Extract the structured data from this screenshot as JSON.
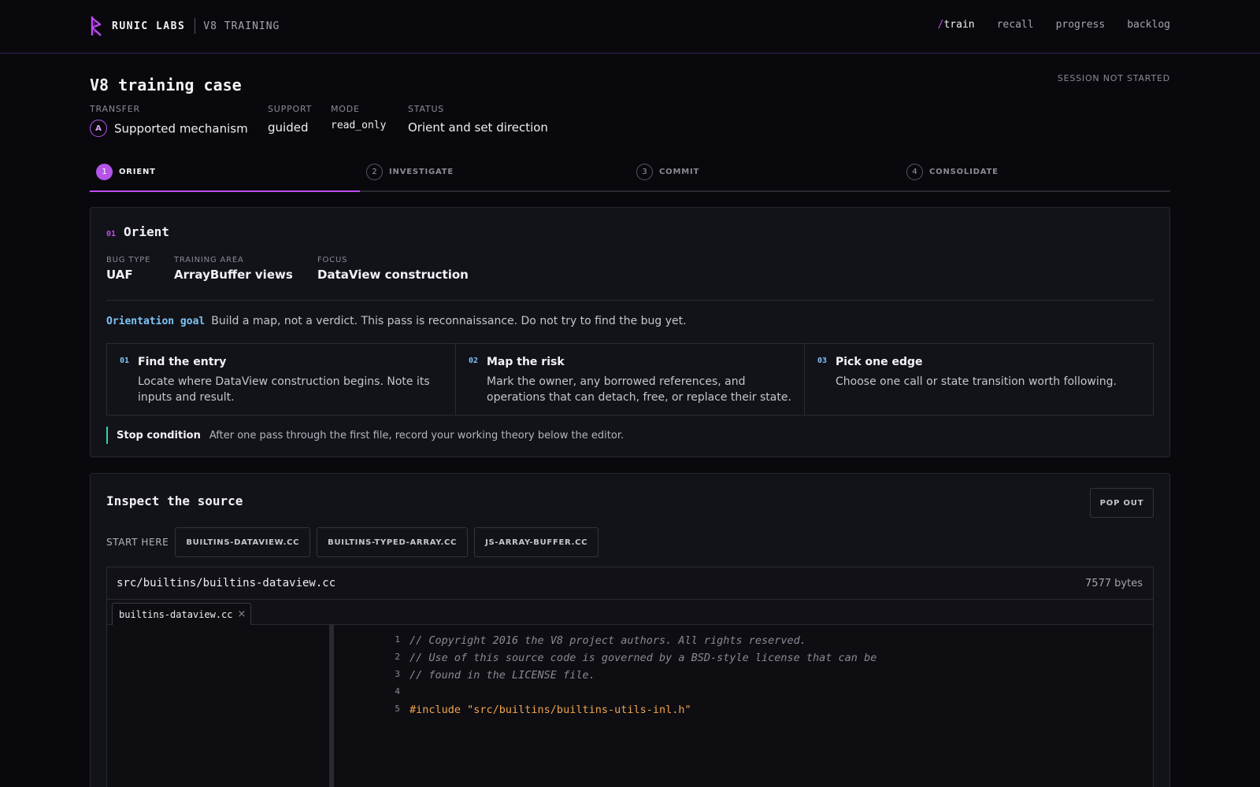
{
  "brand": {
    "name": "RUNIC LABS",
    "subtitle": "V8 TRAINING"
  },
  "nav": {
    "items": [
      {
        "prefix": "/",
        "label": "train",
        "active": true
      },
      {
        "label": "recall"
      },
      {
        "label": "progress"
      },
      {
        "label": "backlog"
      }
    ]
  },
  "header": {
    "title": "V8 training case",
    "session_status": "SESSION NOT STARTED",
    "meta": {
      "transfer": {
        "label": "TRANSFER",
        "badge": "A",
        "value": "Supported mechanism"
      },
      "support": {
        "label": "SUPPORT",
        "value": "guided"
      },
      "mode": {
        "label": "MODE",
        "value": "read_only"
      },
      "status": {
        "label": "STATUS",
        "value": "Orient and set direction"
      }
    }
  },
  "stepper": {
    "steps": [
      {
        "num": "1",
        "label": "ORIENT",
        "active": true
      },
      {
        "num": "2",
        "label": "INVESTIGATE"
      },
      {
        "num": "3",
        "label": "COMMIT"
      },
      {
        "num": "4",
        "label": "CONSOLIDATE"
      }
    ]
  },
  "orient": {
    "num": "01",
    "title": "Orient",
    "facts": [
      {
        "label": "BUG TYPE",
        "value": "UAF"
      },
      {
        "label": "TRAINING AREA",
        "value": "ArrayBuffer views"
      },
      {
        "label": "FOCUS",
        "value": "DataView construction"
      }
    ],
    "goal": {
      "label": "Orientation goal",
      "text": "Build a map, not a verdict. This pass is reconnaissance. Do not try to find the bug yet."
    },
    "tasks": [
      {
        "num": "01",
        "title": "Find the entry",
        "text": "Locate where DataView construction begins. Note its inputs and result."
      },
      {
        "num": "02",
        "title": "Map the risk",
        "text": "Mark the owner, any borrowed references, and operations that can detach, free, or replace their state."
      },
      {
        "num": "03",
        "title": "Pick one edge",
        "text": "Choose one call or state transition worth following."
      }
    ],
    "stop": {
      "label": "Stop condition",
      "text": "After one pass through the first file, record your working theory below the editor."
    }
  },
  "source": {
    "title": "Inspect the source",
    "popout_label": "POP OUT",
    "start_label": "START HERE",
    "files": [
      "BUILTINS-DATAVIEW.CC",
      "BUILTINS-TYPED-ARRAY.CC",
      "JS-ARRAY-BUFFER.CC"
    ],
    "editor": {
      "path": "src/builtins/builtins-dataview.cc",
      "size": "7577 bytes",
      "tab_name": "builtins-dataview.cc",
      "tab_close": "×",
      "lines": [
        {
          "n": "1",
          "text": "// Copyright 2016 the V8 project authors. All rights reserved.",
          "kind": "comment"
        },
        {
          "n": "2",
          "text": "// Use of this source code is governed by a BSD-style license that can be",
          "kind": "comment"
        },
        {
          "n": "3",
          "text": "// found in the LICENSE file.",
          "kind": "comment"
        },
        {
          "n": "4",
          "text": "",
          "kind": "plain"
        },
        {
          "n": "5",
          "text": "#include \"src/builtins/builtins-utils-inl.h\"",
          "kind": "include"
        }
      ]
    }
  },
  "colors": {
    "accent": "#c04cf0",
    "link_blue": "#7cc5f5",
    "stop_green": "#34d0b0",
    "include_orange": "#f0a44a",
    "background": "#09090d"
  }
}
